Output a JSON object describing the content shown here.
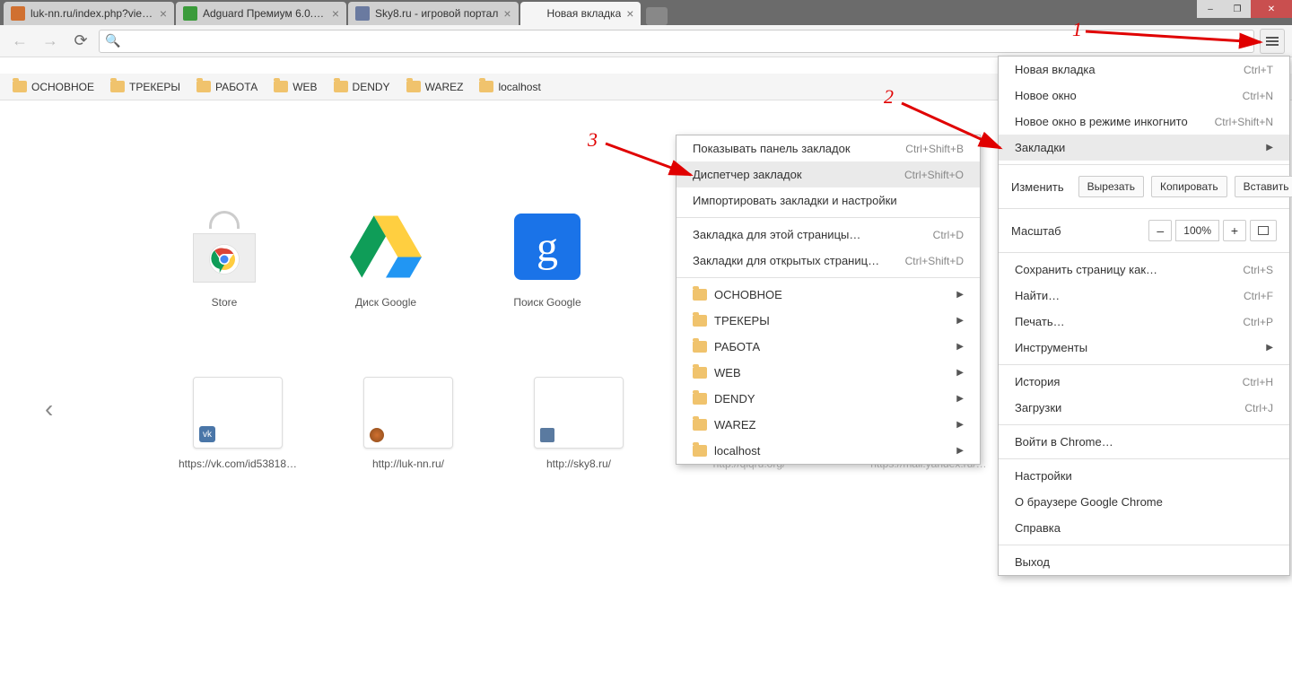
{
  "window": {
    "min": "–",
    "max": "❐",
    "close": "✕"
  },
  "tabs": [
    {
      "label": "luk-nn.ru/index.php?view…",
      "favicon": "#d07030"
    },
    {
      "label": "Adguard Премиум 6.0.22…",
      "favicon": "#3a9b3a"
    },
    {
      "label": "Sky8.ru - игровой портал",
      "favicon": "#6a7aa0"
    },
    {
      "label": "Новая вкладка",
      "favicon": ""
    }
  ],
  "toolbar": {
    "omnibox_placeholder": ""
  },
  "bookmarks_bar": [
    "ОСНОВНОЕ",
    "ТРЕКЕРЫ",
    "РАБОТА",
    "WEB",
    "DENDY",
    "WAREZ",
    "localhost"
  ],
  "ntp_tiles_top": [
    {
      "label": "Store"
    },
    {
      "label": "Диск Google"
    },
    {
      "label": "Поиск Google"
    }
  ],
  "ntp_tiles_bottom": [
    {
      "label": "https://vk.com/id53818…"
    },
    {
      "label": "http://luk-nn.ru/"
    },
    {
      "label": "http://sky8.ru/"
    },
    {
      "label": "http://qiqru.org/"
    },
    {
      "label": "https://mail.yandex.ru/…"
    }
  ],
  "main_menu": {
    "new_tab": {
      "label": "Новая вкладка",
      "shortcut": "Ctrl+T"
    },
    "new_window": {
      "label": "Новое окно",
      "shortcut": "Ctrl+N"
    },
    "incognito": {
      "label": "Новое окно в режиме инкогнито",
      "shortcut": "Ctrl+Shift+N"
    },
    "bookmarks": {
      "label": "Закладки"
    },
    "edit_label": "Изменить",
    "cut": "Вырезать",
    "copy": "Копировать",
    "paste": "Вставить",
    "zoom_label": "Масштаб",
    "zoom_value": "100%",
    "zoom_minus": "–",
    "zoom_plus": "+",
    "save_as": {
      "label": "Сохранить страницу как…",
      "shortcut": "Ctrl+S"
    },
    "find": {
      "label": "Найти…",
      "shortcut": "Ctrl+F"
    },
    "print": {
      "label": "Печать…",
      "shortcut": "Ctrl+P"
    },
    "tools": {
      "label": "Инструменты"
    },
    "history": {
      "label": "История",
      "shortcut": "Ctrl+H"
    },
    "downloads": {
      "label": "Загрузки",
      "shortcut": "Ctrl+J"
    },
    "signin": {
      "label": "Войти в Chrome…"
    },
    "settings": {
      "label": "Настройки"
    },
    "about": {
      "label": "О браузере Google Chrome"
    },
    "help": {
      "label": "Справка"
    },
    "exit": {
      "label": "Выход"
    }
  },
  "bookmarks_submenu": {
    "show_bar": {
      "label": "Показывать панель закладок",
      "shortcut": "Ctrl+Shift+B"
    },
    "manager": {
      "label": "Диспетчер закладок",
      "shortcut": "Ctrl+Shift+O"
    },
    "import": {
      "label": "Импортировать закладки и настройки"
    },
    "this_page": {
      "label": "Закладка для этой страницы…",
      "shortcut": "Ctrl+D"
    },
    "open_pages": {
      "label": "Закладки для открытых страниц…",
      "shortcut": "Ctrl+Shift+D"
    },
    "folders": [
      "ОСНОВНОЕ",
      "ТРЕКЕРЫ",
      "РАБОТА",
      "WEB",
      "DENDY",
      "WAREZ",
      "localhost"
    ]
  },
  "annotations": {
    "n1": "1",
    "n2": "2",
    "n3": "3"
  }
}
